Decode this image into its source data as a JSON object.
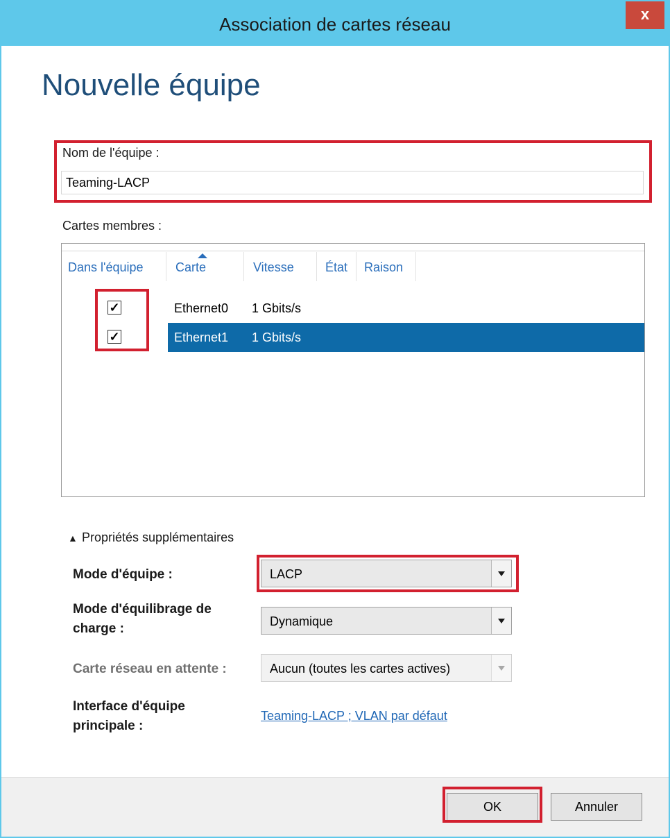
{
  "window": {
    "title": "Association de cartes réseau",
    "close_label": "x"
  },
  "page": {
    "title": "Nouvelle équipe"
  },
  "team_name": {
    "label": "Nom de l'équipe :",
    "value": "Teaming-LACP"
  },
  "members": {
    "label": "Cartes membres :",
    "columns": [
      "Dans l'équipe",
      "Carte",
      "Vitesse",
      "État",
      "Raison"
    ],
    "sorted_column": "Carte",
    "rows": [
      {
        "in_team": true,
        "card": "Ethernet0",
        "speed": "1 Gbits/s",
        "state": "",
        "reason": "",
        "selected": false
      },
      {
        "in_team": true,
        "card": "Ethernet1",
        "speed": "1 Gbits/s",
        "state": "",
        "reason": "",
        "selected": true
      }
    ]
  },
  "additional": {
    "toggle_label": "Propriétés supplémentaires",
    "team_mode_label": "Mode d'équipe :",
    "team_mode_value": "LACP",
    "load_balancing_label_line1": "Mode d'équilibrage de",
    "load_balancing_label_line2": "charge :",
    "load_balancing_value": "Dynamique",
    "standby_label": "Carte réseau en attente :",
    "standby_value": "Aucun (toutes les cartes actives)",
    "primary_interface_label_line1": "Interface d'équipe",
    "primary_interface_label_line2": "principale :",
    "primary_interface_link": "Teaming-LACP ; VLAN par défaut"
  },
  "footer": {
    "ok_label": "OK",
    "cancel_label": "Annuler"
  },
  "colors": {
    "title_bar": "#5ec8ea",
    "highlight_box": "#d2202f",
    "selection": "#0e6aa8",
    "link": "#1e66b5"
  }
}
